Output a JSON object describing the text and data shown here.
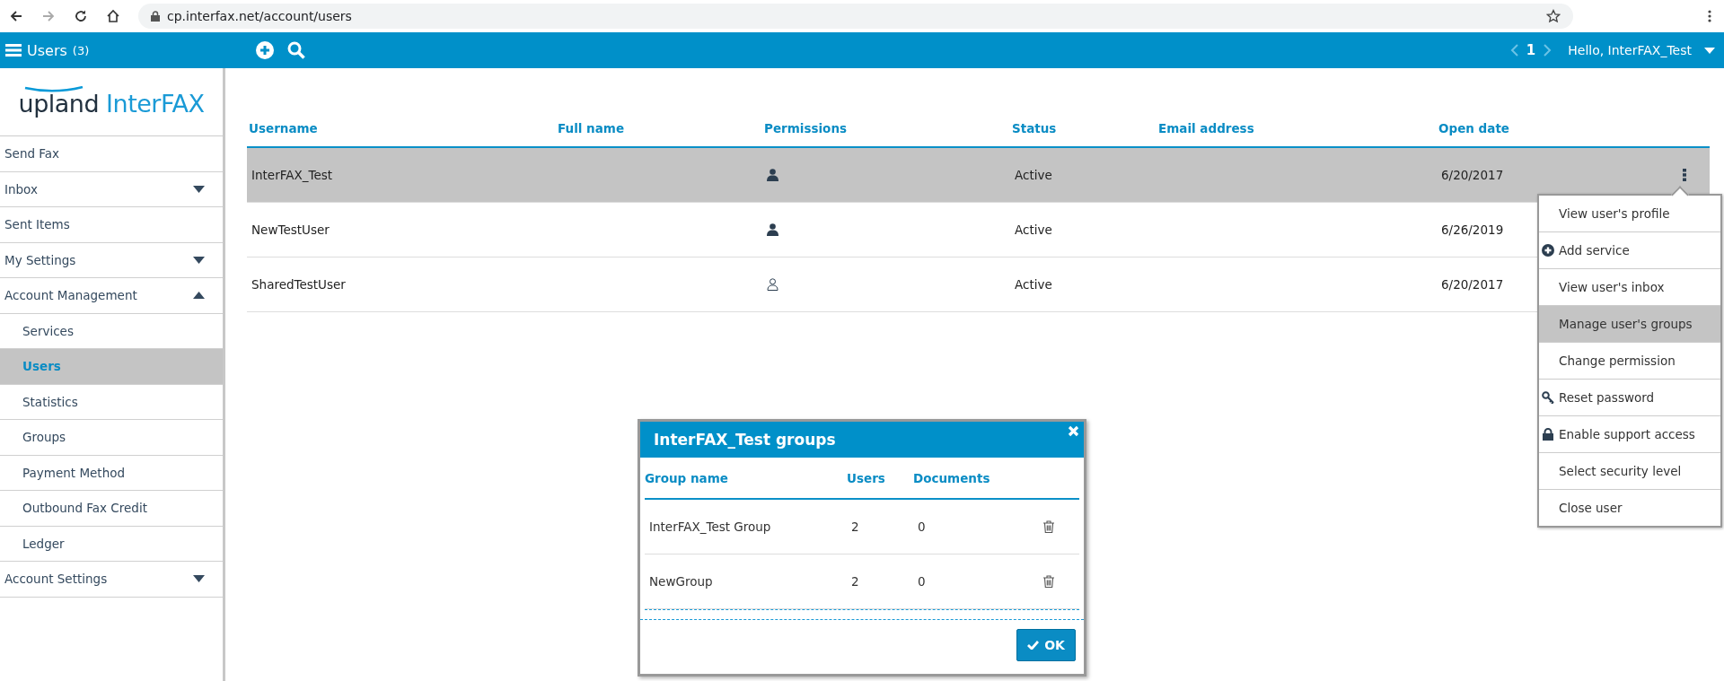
{
  "browser": {
    "url": "cp.interfax.net/account/users",
    "forward_disabled": true
  },
  "app_bar": {
    "title": "Users",
    "count": "(3)",
    "page": "1",
    "greeting": "Hello, InterFAX_Test"
  },
  "logo": {
    "brand": "upland",
    "product": "InterFAX"
  },
  "sidebar": {
    "items": [
      {
        "label": "Send Fax",
        "selected": false
      },
      {
        "label": "Inbox",
        "selected": false,
        "expanded": false
      },
      {
        "label": "Sent Items",
        "selected": false
      },
      {
        "label": "My Settings",
        "selected": false,
        "expanded": false
      },
      {
        "label": "Account Management",
        "selected": false,
        "expanded": true,
        "children": [
          {
            "label": "Services",
            "selected": false
          },
          {
            "label": "Users",
            "selected": true
          },
          {
            "label": "Statistics",
            "selected": false
          },
          {
            "label": "Groups",
            "selected": false
          },
          {
            "label": "Payment Method",
            "selected": false
          },
          {
            "label": "Outbound Fax Credit",
            "selected": false
          },
          {
            "label": "Ledger",
            "selected": false
          }
        ]
      },
      {
        "label": "Account Settings",
        "selected": false,
        "expanded": false
      }
    ]
  },
  "table": {
    "columns": [
      "Username",
      "Full name",
      "Permissions",
      "Status",
      "Email address",
      "Open date"
    ],
    "rows": [
      {
        "username": "InterFAX_Test",
        "permission_filled": true,
        "status": "Active",
        "open_date": "6/20/2017",
        "selected": true
      },
      {
        "username": "NewTestUser",
        "permission_filled": true,
        "status": "Active",
        "open_date": "6/26/2019",
        "selected": false
      },
      {
        "username": "SharedTestUser",
        "permission_filled": false,
        "status": "Active",
        "open_date": "6/20/2017",
        "selected": false
      }
    ]
  },
  "row_menu": {
    "items": [
      {
        "label": "View user's profile",
        "kind": "plain",
        "selected": false
      },
      {
        "label": "Add service",
        "kind": "add",
        "selected": false
      },
      {
        "label": "View user's inbox",
        "kind": "plain",
        "selected": false
      },
      {
        "label": "Manage user's groups",
        "kind": "plain",
        "selected": true
      },
      {
        "label": "Change permission",
        "kind": "plain",
        "selected": false
      },
      {
        "label": "Reset password",
        "kind": "key",
        "selected": false
      },
      {
        "label": "Enable support access",
        "kind": "lock",
        "selected": false
      },
      {
        "label": "Select security level",
        "kind": "plain",
        "selected": false
      },
      {
        "label": "Close user",
        "kind": "plain",
        "selected": false
      }
    ]
  },
  "dialog": {
    "title": "InterFAX_Test groups",
    "columns": [
      "Group name",
      "Users",
      "Documents"
    ],
    "rows": [
      {
        "name": "InterFAX_Test Group",
        "users": "2",
        "documents": "0"
      },
      {
        "name": "NewGroup",
        "users": "2",
        "documents": "0"
      }
    ],
    "ok_label": "OK"
  }
}
